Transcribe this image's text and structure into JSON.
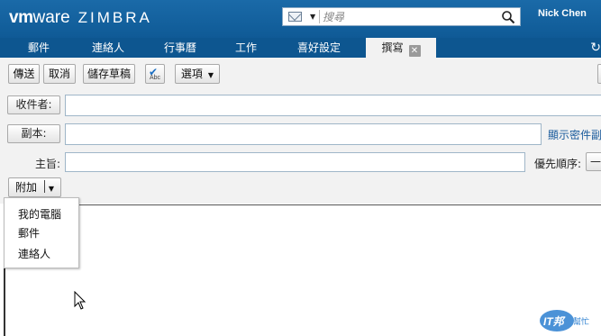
{
  "header": {
    "logo_vm": "vm",
    "logo_ware": "ware",
    "logo_zimbra": "ZIMBRA",
    "search_placeholder": "搜尋",
    "user_name": "Nick Chen"
  },
  "tabs": [
    {
      "label": "郵件"
    },
    {
      "label": "連絡人"
    },
    {
      "label": "行事曆"
    },
    {
      "label": "工作"
    },
    {
      "label": "喜好設定"
    },
    {
      "label": "撰寫",
      "active": true
    }
  ],
  "toolbar": {
    "send": "傳送",
    "cancel": "取消",
    "save_draft": "儲存草稿",
    "spell_text": "Abc",
    "options": "選項"
  },
  "form": {
    "to_label": "收件者:",
    "cc_label": "副本:",
    "show_bcc": "顯示密件副",
    "subject_label": "主旨:",
    "priority_label": "優先順序:",
    "priority_value": "—",
    "attach_label": "附加"
  },
  "attach_menu": [
    {
      "label": "我的電腦"
    },
    {
      "label": "郵件"
    },
    {
      "label": "連絡人"
    }
  ],
  "watermark": {
    "text1": "IT邦",
    "text2": "幫忙"
  },
  "colors": {
    "header_blue": "#1a6aa8",
    "tab_blue": "#0d5690",
    "link_blue": "#1a5b9c"
  }
}
